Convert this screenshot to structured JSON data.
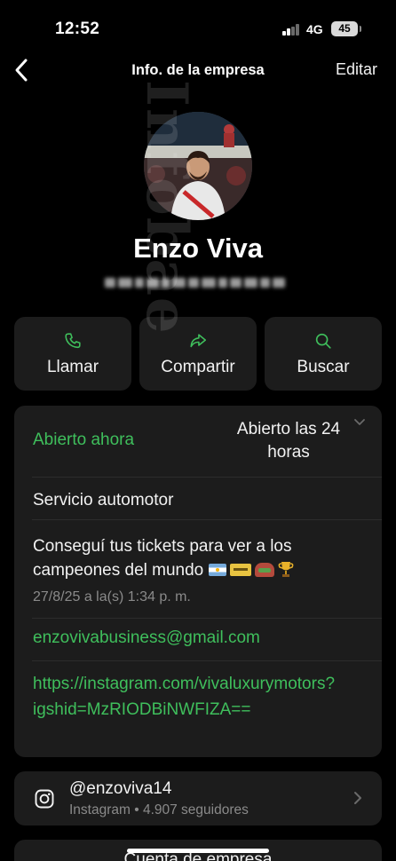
{
  "status_bar": {
    "time": "12:52",
    "network": "4G",
    "battery": "45"
  },
  "nav": {
    "title": "Info. de la empresa",
    "edit_label": "Editar"
  },
  "profile": {
    "name": "Enzo Viva",
    "phone_blurred": true
  },
  "actions": [
    {
      "label": "Llamar",
      "icon": "phone-icon"
    },
    {
      "label": "Compartir",
      "icon": "share-icon"
    },
    {
      "label": "Buscar",
      "icon": "search-icon"
    }
  ],
  "business": {
    "status": "Abierto ahora",
    "hours": "Abierto las 24 horas",
    "category": "Servicio automotor",
    "about": "Conseguí tus tickets para ver a los campeones del mundo",
    "about_emojis": [
      "argentina-flag",
      "ticket",
      "stadium",
      "trophy"
    ],
    "about_time": "27/8/25 a la(s) 1:34 p. m.",
    "email": "enzovivabusiness@gmail.com",
    "website": "https://instagram.com/vivaluxurymotors?igshid=MzRIODBiNWFIZA=="
  },
  "instagram": {
    "handle": "@enzoviva14",
    "meta": "Instagram • 4.907 seguidores",
    "icon": "instagram-icon"
  },
  "next_section": {
    "title": "Cuenta de empresa"
  },
  "watermark": {
    "text": "Infobae"
  },
  "colors": {
    "background": "#000000",
    "card": "#1c1c1c",
    "accent_green": "#3fbf5c",
    "muted": "#8a8a8a"
  }
}
